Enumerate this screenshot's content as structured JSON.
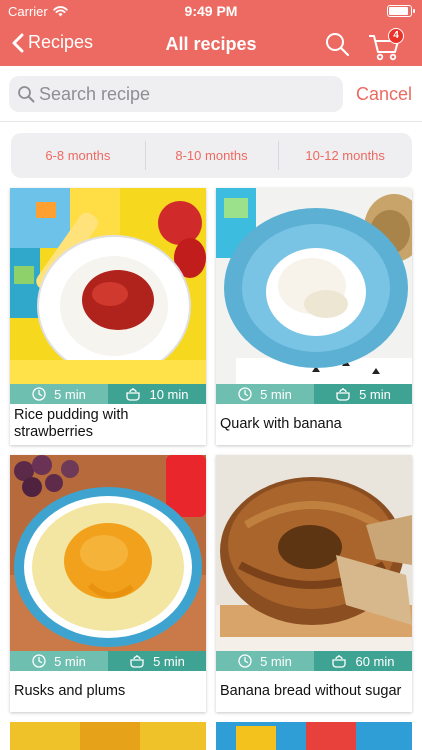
{
  "status_bar": {
    "carrier": "Carrier",
    "time": "9:49 PM"
  },
  "nav": {
    "back_label": "Recipes",
    "title": "All recipes",
    "cart_count": "4"
  },
  "search": {
    "placeholder": "Search recipe",
    "value": "",
    "cancel_label": "Cancel"
  },
  "age_filters": [
    "6-8 months",
    "8-10 months",
    "10-12 months"
  ],
  "recipes": [
    {
      "name": "Rice pudding with strawberries",
      "prep_time": "5 min",
      "cook_time": "10 min"
    },
    {
      "name": "Quark with banana",
      "prep_time": "5 min",
      "cook_time": "5 min"
    },
    {
      "name": "Rusks and plums",
      "prep_time": "5 min",
      "cook_time": "5 min"
    },
    {
      "name": "Banana bread without sugar",
      "prep_time": "5 min",
      "cook_time": "60 min"
    }
  ],
  "colors": {
    "brand": "#ec6a61",
    "prep_bar": "#6ebfb0",
    "cook_bar": "#3fa393",
    "badge": "#e8322a"
  }
}
